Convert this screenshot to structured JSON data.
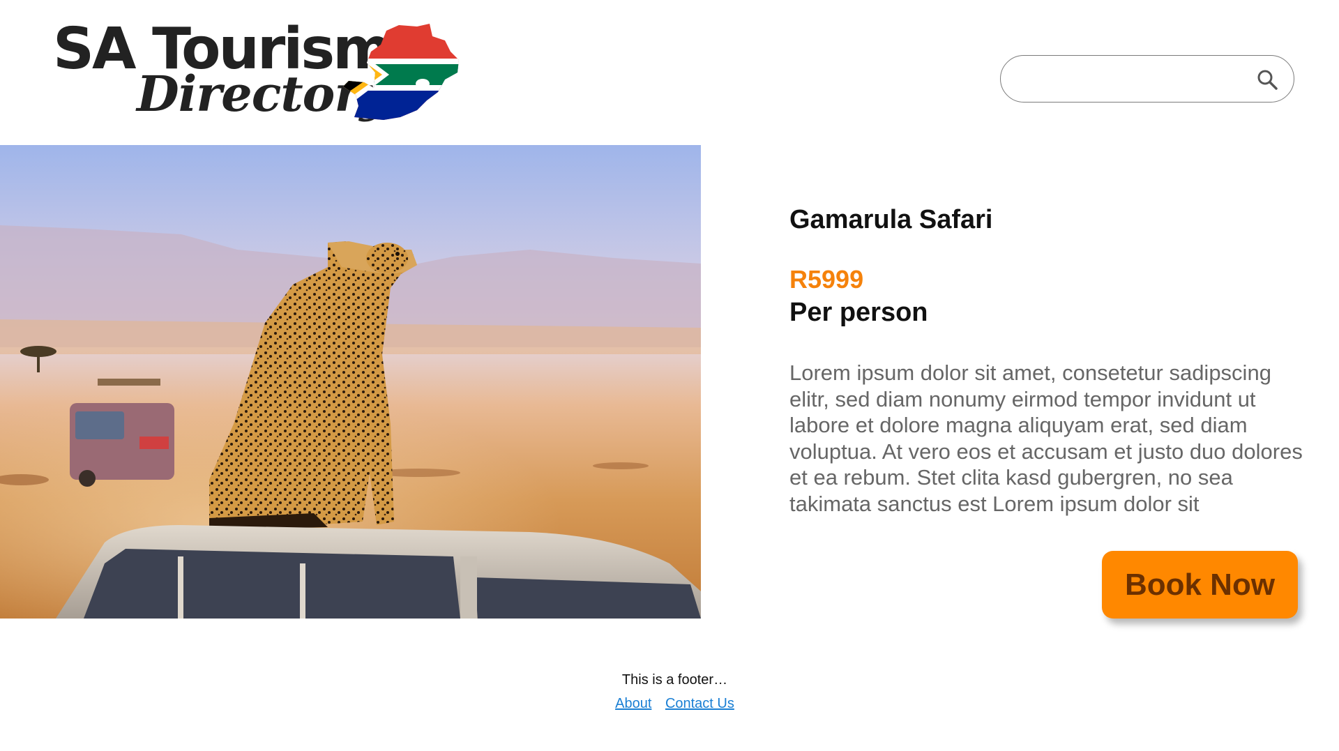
{
  "header": {
    "logo": {
      "line1": "SA Tourism",
      "line2": "Directory"
    },
    "search": {
      "value": "",
      "placeholder": "",
      "icon": "search-icon"
    }
  },
  "hero": {
    "image_description_icon": "cheetah-photo"
  },
  "listing": {
    "title": "Gamarula Safari",
    "price": "R5999",
    "price_unit": "Per person",
    "description": "Lorem ipsum dolor sit amet, consetetur sadipscing elitr, sed diam nonumy eirmod tempor invidunt ut labore et dolore magna aliquyam erat, sed diam voluptua. At vero eos et accusam et justo duo dolores et ea rebum. Stet clita kasd gubergren, no sea takimata sanctus est Lorem ipsum dolor sit",
    "book_label": "Book Now"
  },
  "footer": {
    "text": "This is a footer…",
    "links": [
      "About",
      "Contact Us"
    ]
  },
  "colors": {
    "accent": "#ff8800",
    "price": "#f5820b",
    "book_text": "#6b3000",
    "link": "#1a7fd4",
    "body_text": "#666666"
  }
}
